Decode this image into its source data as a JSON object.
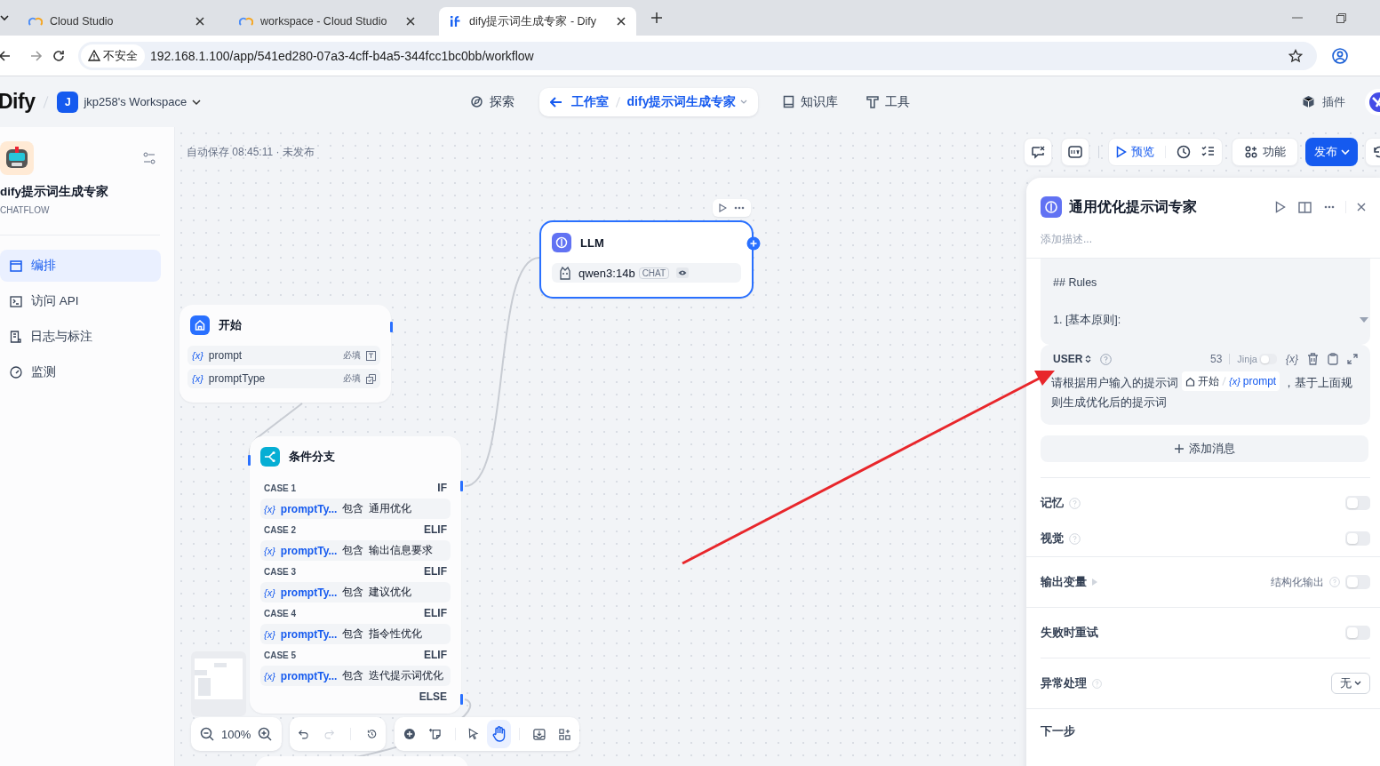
{
  "browser": {
    "tabs": [
      {
        "title": "Cloud Studio",
        "selected": false
      },
      {
        "title": "workspace - Cloud Studio",
        "selected": false
      },
      {
        "title": "dify提示词生成专家 - Dify",
        "selected": true
      }
    ],
    "address": {
      "security": "不安全",
      "url": "192.168.1.100/app/541ed280-07a3-4cff-b4a5-344fcc1bc0bb/workflow"
    }
  },
  "header": {
    "logo": "Dify",
    "workspace": {
      "initial": "J",
      "name": "jkp258's Workspace"
    },
    "nav": [
      {
        "kind": "explore",
        "label": "探索",
        "selected": false
      },
      {
        "kind": "studio",
        "back": "工作室",
        "app": "dify提示词生成专家",
        "selected": true
      },
      {
        "kind": "knowledge",
        "label": "知识库",
        "selected": false
      },
      {
        "kind": "tools",
        "label": "工具",
        "selected": false
      }
    ],
    "plugins": "插件"
  },
  "sidebar": {
    "app_name": "dify提示词生成专家",
    "app_type": "CHATFLOW",
    "items": [
      {
        "kind": "orchestrate",
        "label": "编排",
        "selected": true
      },
      {
        "kind": "api",
        "label": "访问 API",
        "selected": false
      },
      {
        "kind": "logs",
        "label": "日志与标注",
        "selected": false
      },
      {
        "kind": "monitor",
        "label": "监测",
        "selected": false
      }
    ]
  },
  "canvas": {
    "status": "自动保存 08:45:11 · 未发布",
    "toolbar": {
      "preview": "预览",
      "features": "功能",
      "publish": "发布"
    },
    "zoom": "100%",
    "start": {
      "title": "开始",
      "variables": [
        {
          "icon": "{x}",
          "name": "prompt",
          "required": "必填",
          "kind": "text"
        },
        {
          "icon": "{x}",
          "name": "promptType",
          "required": "必填",
          "kind": "select"
        }
      ]
    },
    "llm": {
      "title": "LLM",
      "model": "qwen3:14b",
      "mode": "CHAT"
    },
    "branch": {
      "title": "条件分支",
      "cases": [
        {
          "label": "CASE 1",
          "keyword": "IF",
          "icon": "{x}",
          "variable": "promptTy...",
          "operator": "包含",
          "value": "通用优化"
        },
        {
          "label": "CASE 2",
          "keyword": "ELIF",
          "icon": "{x}",
          "variable": "promptTy...",
          "operator": "包含",
          "value": "输出信息要求"
        },
        {
          "label": "CASE 3",
          "keyword": "ELIF",
          "icon": "{x}",
          "variable": "promptTy...",
          "operator": "包含",
          "value": "建议优化"
        },
        {
          "label": "CASE 4",
          "keyword": "ELIF",
          "icon": "{x}",
          "variable": "promptTy...",
          "operator": "包含",
          "value": "指令性优化"
        },
        {
          "label": "CASE 5",
          "keyword": "ELIF",
          "icon": "{x}",
          "variable": "promptTy...",
          "operator": "包含",
          "value": "迭代提示词优化"
        }
      ],
      "else": "ELSE"
    }
  },
  "panel": {
    "title": "通用优化提示词专家",
    "description_placeholder": "添加描述...",
    "system_lines": [
      "## Rules",
      "1. [基本原则]:"
    ],
    "user": {
      "role": "USER",
      "count": "53",
      "jinja": "Jinja",
      "jinja_on": false,
      "var_icon": "{x}",
      "text_before": "请根据用户输入的提示词",
      "chip_node": "开始",
      "chip_icon": "{x}",
      "chip_var": "prompt",
      "text_after": "，基于上面规则生成优化后的提示词"
    },
    "add_message": "添加消息",
    "settings": [
      {
        "kind": "toggle",
        "label": "记忆",
        "help": true,
        "on": false
      },
      {
        "kind": "toggle",
        "label": "视觉",
        "help": true,
        "on": false
      },
      {
        "kind": "output",
        "label": "输出变量",
        "extra": "结构化输出",
        "on": false
      },
      {
        "kind": "toggle",
        "label": "失败时重试",
        "help": false,
        "on": false
      },
      {
        "kind": "select",
        "label": "异常处理",
        "value": "无"
      },
      {
        "kind": "heading",
        "label": "下一步"
      }
    ]
  }
}
